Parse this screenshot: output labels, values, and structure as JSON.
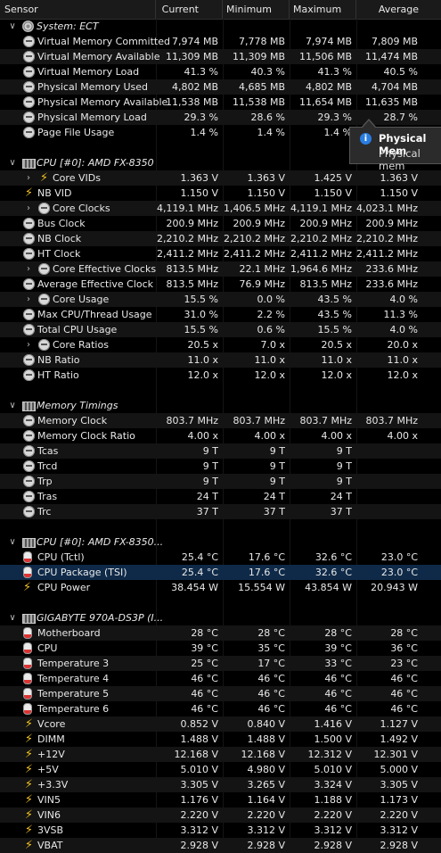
{
  "header": {
    "sensor": "Sensor",
    "current": "Current",
    "minimum": "Minimum",
    "maximum": "Maximum",
    "average": "Average"
  },
  "tooltip": {
    "title": "Physical Mem",
    "body": "Physical mem"
  },
  "rows": [
    {
      "k": "group",
      "icon": "gear",
      "label": "System: ECT",
      "tog": "v"
    },
    {
      "k": "data",
      "icon": "clock",
      "label": "Virtual Memory Committed",
      "cur": "7,974 MB",
      "min": "7,778 MB",
      "max": "7,974 MB",
      "avg": "7,809 MB"
    },
    {
      "k": "data",
      "icon": "clock",
      "label": "Virtual Memory Available",
      "cur": "11,309 MB",
      "min": "11,309 MB",
      "max": "11,506 MB",
      "avg": "11,474 MB"
    },
    {
      "k": "data",
      "icon": "clock",
      "label": "Virtual Memory Load",
      "cur": "41.3 %",
      "min": "40.3 %",
      "max": "41.3 %",
      "avg": "40.5 %"
    },
    {
      "k": "data",
      "icon": "clock",
      "label": "Physical Memory Used",
      "cur": "4,802 MB",
      "min": "4,685 MB",
      "max": "4,802 MB",
      "avg": "4,704 MB"
    },
    {
      "k": "data",
      "icon": "clock",
      "label": "Physical Memory Available",
      "cur": "11,538 MB",
      "min": "11,538 MB",
      "max": "11,654 MB",
      "avg": "11,635 MB"
    },
    {
      "k": "data",
      "icon": "clock",
      "label": "Physical Memory Load",
      "cur": "29.3 %",
      "min": "28.6 %",
      "max": "29.3 %",
      "avg": "28.7 %"
    },
    {
      "k": "data",
      "icon": "clock",
      "label": "Page File Usage",
      "cur": "1.4 %",
      "min": "1.4 %",
      "max": "1.4 %",
      "avg": ""
    },
    {
      "k": "spacer"
    },
    {
      "k": "group",
      "icon": "chip",
      "label": "CPU [#0]: AMD FX-8350",
      "tog": "v"
    },
    {
      "k": "data",
      "icon": "volt",
      "label": "Core VIDs",
      "tog": ">",
      "cur": "1.363 V",
      "min": "1.363 V",
      "max": "1.425 V",
      "avg": "1.363 V"
    },
    {
      "k": "data",
      "icon": "volt",
      "label": "NB VID",
      "cur": "1.150 V",
      "min": "1.150 V",
      "max": "1.150 V",
      "avg": "1.150 V"
    },
    {
      "k": "data",
      "icon": "clock",
      "label": "Core Clocks",
      "tog": ">",
      "cur": "4,119.1 MHz",
      "min": "1,406.5 MHz",
      "max": "4,119.1 MHz",
      "avg": "4,023.1 MHz"
    },
    {
      "k": "data",
      "icon": "clock",
      "label": "Bus Clock",
      "cur": "200.9 MHz",
      "min": "200.9 MHz",
      "max": "200.9 MHz",
      "avg": "200.9 MHz"
    },
    {
      "k": "data",
      "icon": "clock",
      "label": "NB Clock",
      "cur": "2,210.2 MHz",
      "min": "2,210.2 MHz",
      "max": "2,210.2 MHz",
      "avg": "2,210.2 MHz"
    },
    {
      "k": "data",
      "icon": "clock",
      "label": "HT Clock",
      "cur": "2,411.2 MHz",
      "min": "2,411.2 MHz",
      "max": "2,411.2 MHz",
      "avg": "2,411.2 MHz"
    },
    {
      "k": "data",
      "icon": "clock",
      "label": "Core Effective Clocks",
      "tog": ">",
      "cur": "813.5 MHz",
      "min": "22.1 MHz",
      "max": "1,964.6 MHz",
      "avg": "233.6 MHz"
    },
    {
      "k": "data",
      "icon": "clock",
      "label": "Average Effective Clock",
      "cur": "813.5 MHz",
      "min": "76.9 MHz",
      "max": "813.5 MHz",
      "avg": "233.6 MHz"
    },
    {
      "k": "data",
      "icon": "clock",
      "label": "Core Usage",
      "tog": ">",
      "cur": "15.5 %",
      "min": "0.0 %",
      "max": "43.5 %",
      "avg": "4.0 %"
    },
    {
      "k": "data",
      "icon": "clock",
      "label": "Max CPU/Thread Usage",
      "cur": "31.0 %",
      "min": "2.2 %",
      "max": "43.5 %",
      "avg": "11.3 %"
    },
    {
      "k": "data",
      "icon": "clock",
      "label": "Total CPU Usage",
      "cur": "15.5 %",
      "min": "0.6 %",
      "max": "15.5 %",
      "avg": "4.0 %"
    },
    {
      "k": "data",
      "icon": "clock",
      "label": "Core Ratios",
      "tog": ">",
      "cur": "20.5 x",
      "min": "7.0 x",
      "max": "20.5 x",
      "avg": "20.0 x"
    },
    {
      "k": "data",
      "icon": "clock",
      "label": "NB Ratio",
      "cur": "11.0 x",
      "min": "11.0 x",
      "max": "11.0 x",
      "avg": "11.0 x"
    },
    {
      "k": "data",
      "icon": "clock",
      "label": "HT Ratio",
      "cur": "12.0 x",
      "min": "12.0 x",
      "max": "12.0 x",
      "avg": "12.0 x"
    },
    {
      "k": "spacer"
    },
    {
      "k": "group",
      "icon": "chip",
      "label": "Memory Timings",
      "tog": "v"
    },
    {
      "k": "data",
      "icon": "clock",
      "label": "Memory Clock",
      "cur": "803.7 MHz",
      "min": "803.7 MHz",
      "max": "803.7 MHz",
      "avg": "803.7 MHz"
    },
    {
      "k": "data",
      "icon": "clock",
      "label": "Memory Clock Ratio",
      "cur": "4.00 x",
      "min": "4.00 x",
      "max": "4.00 x",
      "avg": "4.00 x"
    },
    {
      "k": "data",
      "icon": "clock",
      "label": "Tcas",
      "cur": "9 T",
      "min": "9 T",
      "max": "9 T",
      "avg": ""
    },
    {
      "k": "data",
      "icon": "clock",
      "label": "Trcd",
      "cur": "9 T",
      "min": "9 T",
      "max": "9 T",
      "avg": ""
    },
    {
      "k": "data",
      "icon": "clock",
      "label": "Trp",
      "cur": "9 T",
      "min": "9 T",
      "max": "9 T",
      "avg": ""
    },
    {
      "k": "data",
      "icon": "clock",
      "label": "Tras",
      "cur": "24 T",
      "min": "24 T",
      "max": "24 T",
      "avg": ""
    },
    {
      "k": "data",
      "icon": "clock",
      "label": "Trc",
      "cur": "37 T",
      "min": "37 T",
      "max": "37 T",
      "avg": ""
    },
    {
      "k": "spacer"
    },
    {
      "k": "group",
      "icon": "chip",
      "label": "CPU [#0]: AMD FX-8350...",
      "tog": "v"
    },
    {
      "k": "data",
      "icon": "temp",
      "label": "CPU (Tctl)",
      "cur": "25.4 °C",
      "min": "17.6 °C",
      "max": "32.6 °C",
      "avg": "23.0 °C"
    },
    {
      "k": "data",
      "icon": "temp",
      "label": "CPU Package (TSI)",
      "cur": "25.4 °C",
      "min": "17.6 °C",
      "max": "32.6 °C",
      "avg": "23.0 °C",
      "sel": true
    },
    {
      "k": "data",
      "icon": "power",
      "label": "CPU Power",
      "cur": "38.454 W",
      "min": "15.554 W",
      "max": "43.854 W",
      "avg": "20.943 W"
    },
    {
      "k": "spacer"
    },
    {
      "k": "group",
      "icon": "chip",
      "label": "GIGABYTE 970A-DS3P (I...",
      "tog": "v"
    },
    {
      "k": "data",
      "icon": "temp",
      "label": "Motherboard",
      "cur": "28 °C",
      "min": "28 °C",
      "max": "28 °C",
      "avg": "28 °C"
    },
    {
      "k": "data",
      "icon": "temp",
      "label": "CPU",
      "cur": "39 °C",
      "min": "35 °C",
      "max": "39 °C",
      "avg": "36 °C"
    },
    {
      "k": "data",
      "icon": "temp",
      "label": "Temperature 3",
      "cur": "25 °C",
      "min": "17 °C",
      "max": "33 °C",
      "avg": "23 °C"
    },
    {
      "k": "data",
      "icon": "temp",
      "label": "Temperature 4",
      "cur": "46 °C",
      "min": "46 °C",
      "max": "46 °C",
      "avg": "46 °C"
    },
    {
      "k": "data",
      "icon": "temp",
      "label": "Temperature 5",
      "cur": "46 °C",
      "min": "46 °C",
      "max": "46 °C",
      "avg": "46 °C"
    },
    {
      "k": "data",
      "icon": "temp",
      "label": "Temperature 6",
      "cur": "46 °C",
      "min": "46 °C",
      "max": "46 °C",
      "avg": "46 °C"
    },
    {
      "k": "data",
      "icon": "volt",
      "label": "Vcore",
      "cur": "0.852 V",
      "min": "0.840 V",
      "max": "1.416 V",
      "avg": "1.127 V"
    },
    {
      "k": "data",
      "icon": "volt",
      "label": "DIMM",
      "cur": "1.488 V",
      "min": "1.488 V",
      "max": "1.500 V",
      "avg": "1.492 V"
    },
    {
      "k": "data",
      "icon": "volt",
      "label": "+12V",
      "cur": "12.168 V",
      "min": "12.168 V",
      "max": "12.312 V",
      "avg": "12.301 V"
    },
    {
      "k": "data",
      "icon": "volt",
      "label": "+5V",
      "cur": "5.010 V",
      "min": "4.980 V",
      "max": "5.010 V",
      "avg": "5.000 V"
    },
    {
      "k": "data",
      "icon": "volt",
      "label": "+3.3V",
      "cur": "3.305 V",
      "min": "3.265 V",
      "max": "3.324 V",
      "avg": "3.305 V"
    },
    {
      "k": "data",
      "icon": "volt",
      "label": "VIN5",
      "cur": "1.176 V",
      "min": "1.164 V",
      "max": "1.188 V",
      "avg": "1.173 V"
    },
    {
      "k": "data",
      "icon": "volt",
      "label": "VIN6",
      "cur": "2.220 V",
      "min": "2.220 V",
      "max": "2.220 V",
      "avg": "2.220 V"
    },
    {
      "k": "data",
      "icon": "volt",
      "label": "3VSB",
      "cur": "3.312 V",
      "min": "3.312 V",
      "max": "3.312 V",
      "avg": "3.312 V"
    },
    {
      "k": "data",
      "icon": "volt",
      "label": "VBAT",
      "cur": "2.928 V",
      "min": "2.928 V",
      "max": "2.928 V",
      "avg": "2.928 V"
    }
  ]
}
